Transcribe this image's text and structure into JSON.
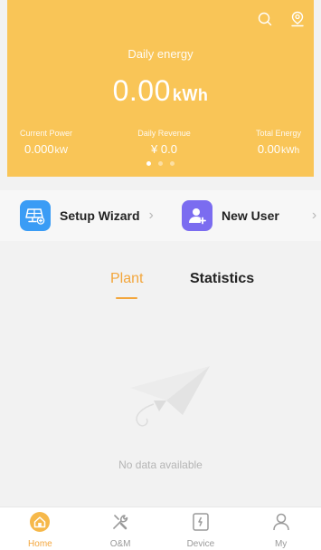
{
  "header": {
    "title": "Daily energy",
    "value": "0.00",
    "unit": "kWh",
    "stats": [
      {
        "label": "Current Power",
        "value": "0.000",
        "unit": "kW"
      },
      {
        "label": "Daily Revenue",
        "value": "¥ 0.0",
        "unit": ""
      },
      {
        "label": "Total Energy",
        "value": "0.00",
        "unit": "kWh"
      }
    ],
    "pager": {
      "active": 1,
      "count": 3
    }
  },
  "quick_actions": [
    {
      "label": "Setup Wizard",
      "icon": "solar-panel-add-icon",
      "color": "#3a9cf5"
    },
    {
      "label": "New User",
      "icon": "user-add-icon",
      "color": "#7b6cf0"
    }
  ],
  "tabs": [
    {
      "label": "Plant",
      "active": true
    },
    {
      "label": "Statistics",
      "active": false
    }
  ],
  "empty_state": {
    "text": "No data available"
  },
  "tabbar": [
    {
      "label": "Home",
      "icon": "home-icon",
      "active": true
    },
    {
      "label": "O&M",
      "icon": "tools-icon",
      "active": false
    },
    {
      "label": "Device",
      "icon": "device-icon",
      "active": false
    },
    {
      "label": "My",
      "icon": "person-icon",
      "active": false
    }
  ],
  "colors": {
    "accent": "#f3a63c",
    "hero_bg": "#f9c557"
  }
}
